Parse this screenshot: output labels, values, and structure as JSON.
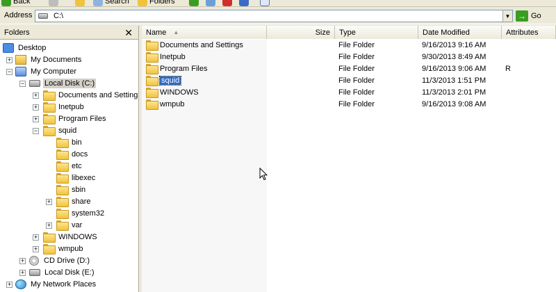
{
  "toolbar": {
    "back_label": "Back",
    "search_label": "Search",
    "folders_label": "Folders"
  },
  "address": {
    "label": "Address",
    "value": "C:\\",
    "go_label": "Go"
  },
  "folders_pane": {
    "title": "Folders",
    "close_glyph": "✕",
    "items": [
      {
        "label": "Desktop"
      },
      {
        "label": "My Documents"
      },
      {
        "label": "My Computer"
      },
      {
        "label": "Local Disk (C:)"
      },
      {
        "label": "Documents and Settings"
      },
      {
        "label": "Inetpub"
      },
      {
        "label": "Program Files"
      },
      {
        "label": "squid"
      },
      {
        "label": "bin"
      },
      {
        "label": "docs"
      },
      {
        "label": "etc"
      },
      {
        "label": "libexec"
      },
      {
        "label": "sbin"
      },
      {
        "label": "share"
      },
      {
        "label": "system32"
      },
      {
        "label": "var"
      },
      {
        "label": "WINDOWS"
      },
      {
        "label": "wmpub"
      },
      {
        "label": "CD Drive (D:)"
      },
      {
        "label": "Local Disk (E:)"
      },
      {
        "label": "My Network Places"
      }
    ]
  },
  "file_list": {
    "columns": [
      "Name",
      "Size",
      "Type",
      "Date Modified",
      "Attributes"
    ],
    "rows": [
      {
        "name": "Documents and Settings",
        "size": "",
        "type": "File Folder",
        "date": "9/16/2013 9:16 AM",
        "attr": ""
      },
      {
        "name": "Inetpub",
        "size": "",
        "type": "File Folder",
        "date": "9/30/2013 8:49 AM",
        "attr": ""
      },
      {
        "name": "Program Files",
        "size": "",
        "type": "File Folder",
        "date": "9/16/2013 9:06 AM",
        "attr": "R"
      },
      {
        "name": "squid",
        "size": "",
        "type": "File Folder",
        "date": "11/3/2013 1:51 PM",
        "attr": ""
      },
      {
        "name": "WINDOWS",
        "size": "",
        "type": "File Folder",
        "date": "11/3/2013 2:01 PM",
        "attr": ""
      },
      {
        "name": "wmpub",
        "size": "",
        "type": "File Folder",
        "date": "9/16/2013 9:08 AM",
        "attr": ""
      }
    ]
  }
}
